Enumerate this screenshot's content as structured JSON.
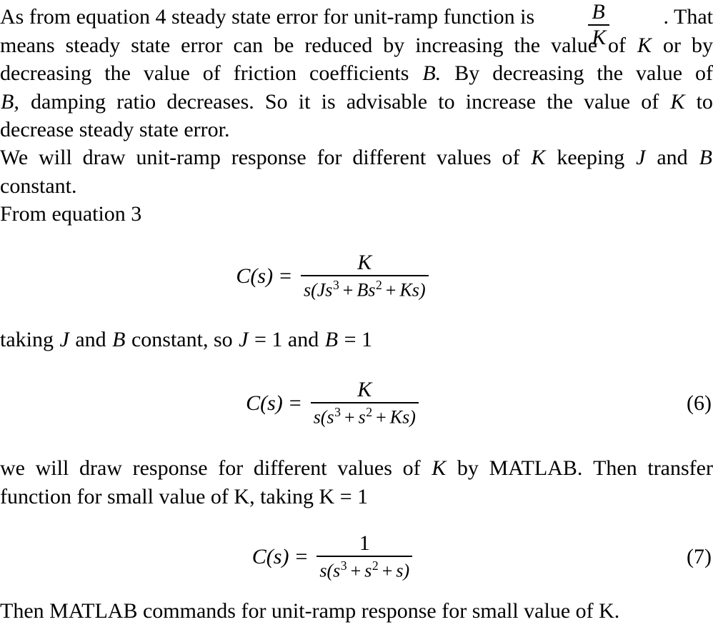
{
  "document": {
    "type": "latex-typeset-page",
    "background": "#ffffff",
    "text_color": "#000000"
  },
  "paragraph1": {
    "line1_pre": "As from equation 4 steady state error for unit-ramp function is",
    "line1_frac_num": "B",
    "line1_frac_den": "K",
    "line1_post": ". That",
    "line2": "means steady state error can be reduced by increasing the value of K or by",
    "line2_words": [
      "means",
      "steady",
      "state",
      "error",
      "can",
      "be",
      "reduced",
      "by",
      "increasing",
      "the",
      "value",
      "of",
      "K",
      "or",
      "by"
    ],
    "line3_words": [
      "decreasing",
      "the",
      "value",
      "of",
      "friction",
      "coefficients",
      "B.",
      "By",
      "decreasing",
      "the",
      "value",
      "of"
    ],
    "line4_words": [
      "B,",
      "damping",
      "ratio",
      "decreases.",
      "So",
      "it",
      "is",
      "advisable",
      "to",
      "increase",
      "the",
      "value",
      "of",
      "K",
      "to"
    ],
    "line5": "decrease steady state error."
  },
  "paragraph2": {
    "line1_words": [
      "We",
      "will",
      "draw",
      "unit-ramp",
      "response",
      "for",
      "different",
      "values",
      "of",
      "K",
      "keeping",
      "J",
      "and",
      "B"
    ],
    "line2": "constant.",
    "line3": "From equation 3"
  },
  "equation_a": {
    "number": "",
    "lhs": "C(s)",
    "equals": "=",
    "numerator": "K",
    "denominator": "s(Js³ + Bs² + Ks)",
    "den_parts": {
      "s_open": "s(",
      "t1_base": "Js",
      "t1_exp": "3",
      "op1": "+",
      "t2_base": "Bs",
      "t2_exp": "2",
      "op2": "+",
      "t3": "Ks",
      "close": ")"
    }
  },
  "paragraph3": {
    "line1_words": [
      "taking",
      "J",
      "and",
      "B",
      "constant,",
      "so",
      "J",
      "=",
      "1",
      "and",
      "B",
      "=",
      "1"
    ],
    "line1": "taking J and B constant, so J = 1 and B = 1"
  },
  "equation_6": {
    "number": "(6)",
    "lhs": "C(s)",
    "equals": "=",
    "numerator": "K",
    "denominator": "s(s³ + s² + Ks)",
    "den_parts": {
      "s_open": "s(",
      "t1_base": "s",
      "t1_exp": "3",
      "op1": "+",
      "t2_base": "s",
      "t2_exp": "2",
      "op2": "+",
      "t3": "Ks",
      "close": ")"
    }
  },
  "paragraph4": {
    "line1_words": [
      "we",
      "will",
      "draw",
      "response",
      "for",
      "different",
      "values",
      "of",
      "K",
      "by",
      "MATLAB.",
      "Then",
      "transfer"
    ],
    "line2": "function for small value of K, taking K = 1"
  },
  "equation_7": {
    "number": "(7)",
    "lhs": "C(s)",
    "equals": "=",
    "numerator": "1",
    "denominator": "s(s³ + s² + s)",
    "den_parts": {
      "s_open": "s(",
      "t1_base": "s",
      "t1_exp": "3",
      "op1": "+",
      "t2_base": "s",
      "t2_exp": "2",
      "op2": "+",
      "t3": "s",
      "close": ")"
    }
  },
  "paragraph5": {
    "line1": "Then MATLAB commands for unit-ramp response for small value of K."
  }
}
